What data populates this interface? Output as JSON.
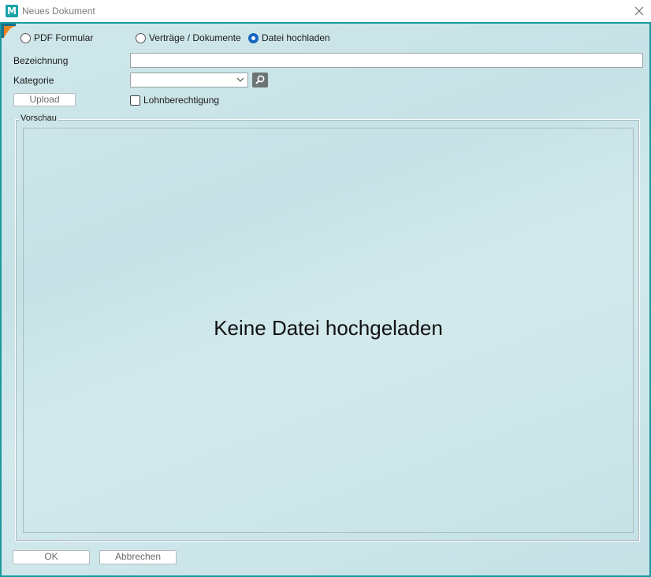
{
  "window": {
    "title": "Neues Dokument",
    "app_icon_letter": "M",
    "accent": "#1a9aa0"
  },
  "radios": [
    {
      "label": "PDF Formular",
      "checked": false
    },
    {
      "label": "Verträge / Dokumente",
      "checked": false
    },
    {
      "label": "Datei hochladen",
      "checked": true
    }
  ],
  "form": {
    "bezeichnung_label": "Bezeichnung",
    "bezeichnung_value": "",
    "kategorie_label": "Kategorie",
    "kategorie_value": "",
    "upload_label": "Upload",
    "lohnberechtigung_label": "Lohnberechtigung",
    "lohnberechtigung_checked": false
  },
  "preview": {
    "legend": "Vorschau",
    "empty_text": "Keine Datei hochgeladen"
  },
  "footer": {
    "ok_label": "OK",
    "cancel_label": "Abbrechen"
  }
}
